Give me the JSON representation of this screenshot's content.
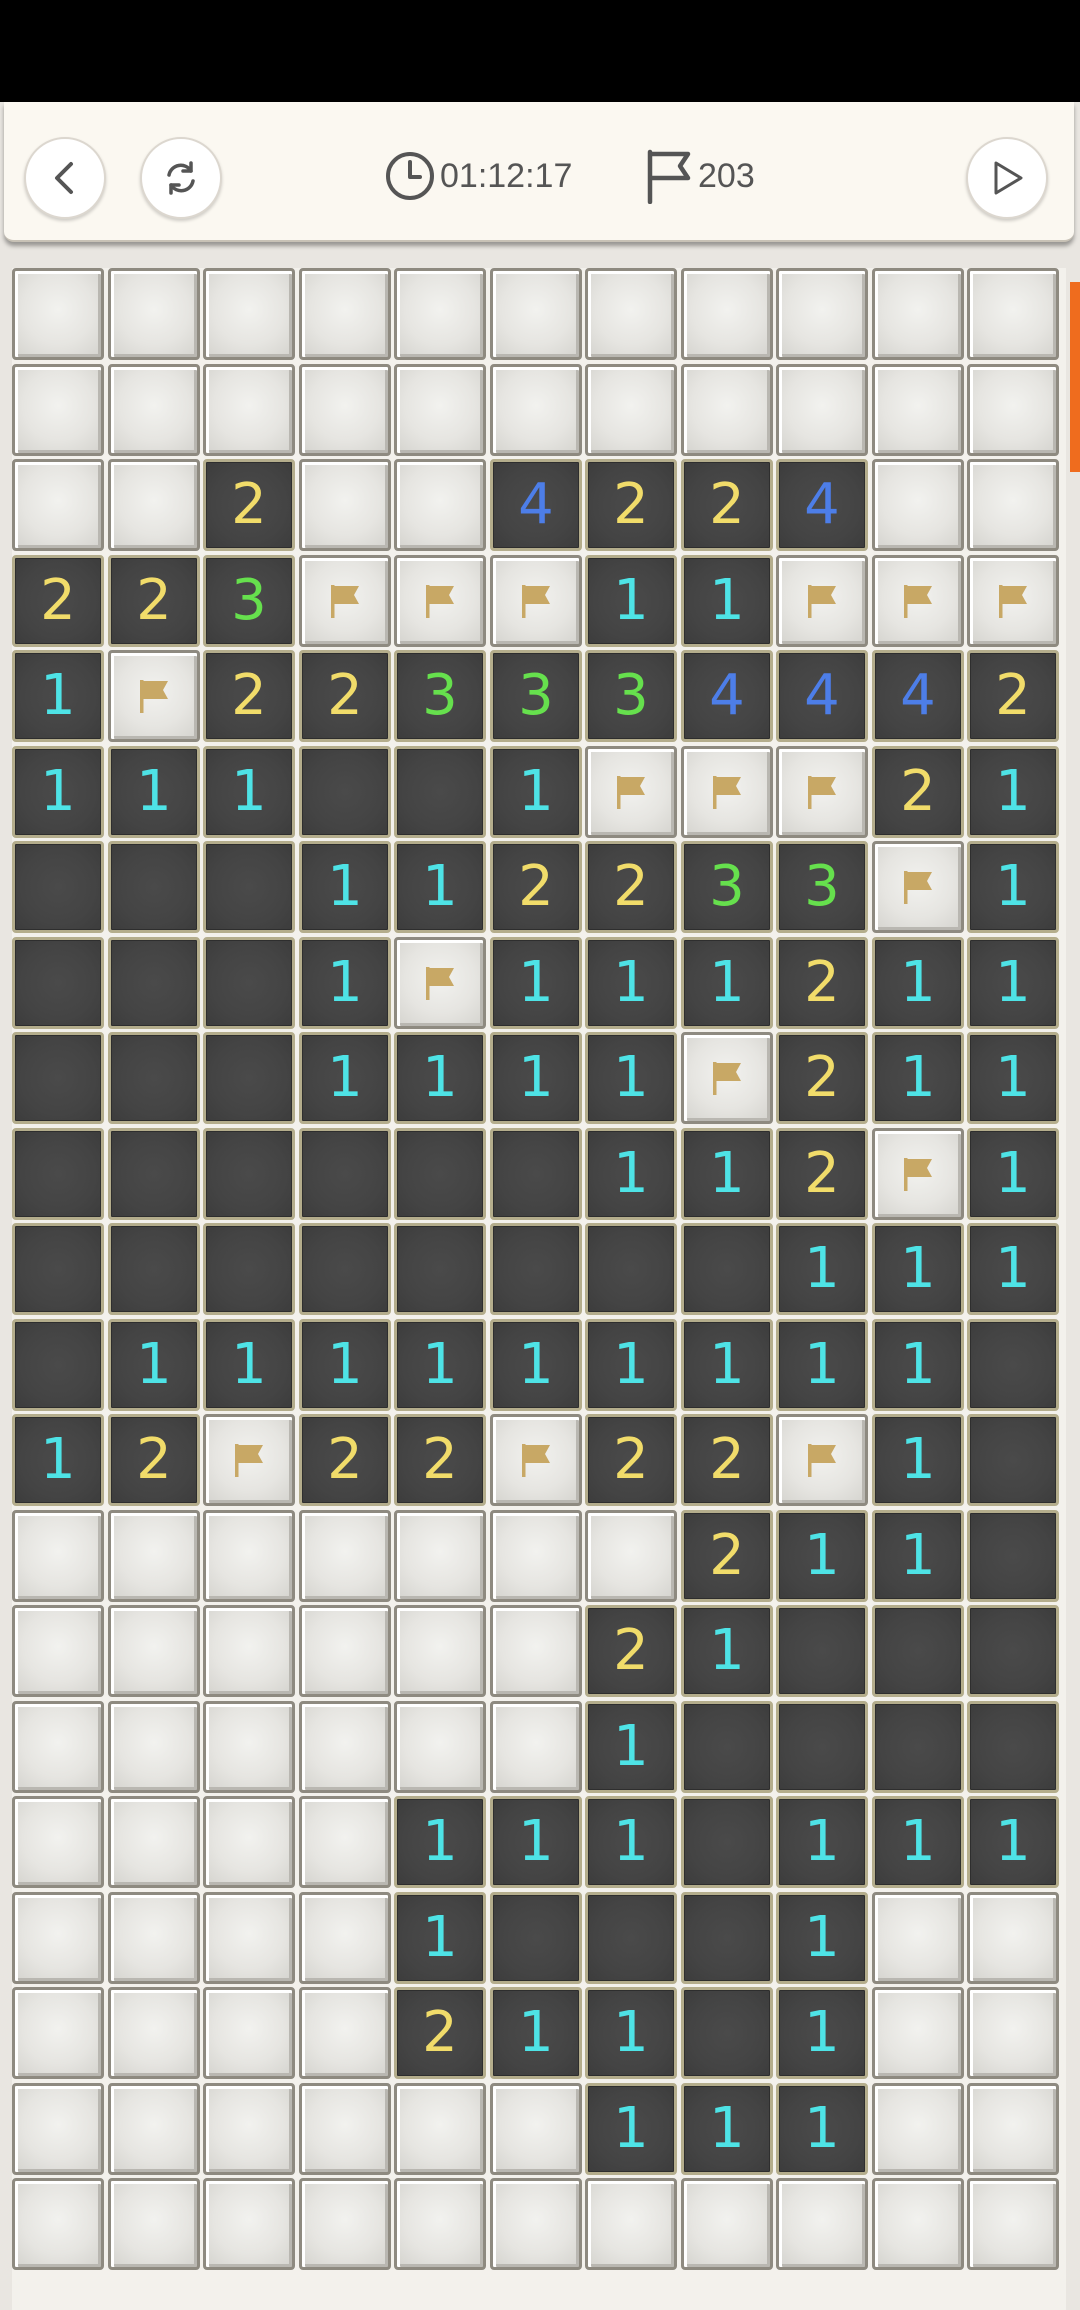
{
  "toolbar": {
    "back_icon": "chevron-left-icon",
    "restart_icon": "refresh-icon",
    "timer_icon": "clock-icon",
    "timer": "01:12:17",
    "flag_icon": "flag-outline-icon",
    "flag_count": "203",
    "play_icon": "play-icon"
  },
  "board": {
    "columns": 11,
    "legend": "C = covered tile, F = flagged tile, 0 = opened blank tile, 1-9 = opened tile showing that number",
    "rows": [
      [
        "C",
        "C",
        "C",
        "C",
        "C",
        "C",
        "C",
        "C",
        "C",
        "C",
        "C"
      ],
      [
        "C",
        "C",
        "C",
        "C",
        "C",
        "C",
        "C",
        "C",
        "C",
        "C",
        "C"
      ],
      [
        "C",
        "C",
        "2",
        "C",
        "C",
        "4",
        "2",
        "2",
        "4",
        "C",
        "C"
      ],
      [
        "2",
        "2",
        "3",
        "F",
        "F",
        "F",
        "1",
        "1",
        "F",
        "F",
        "F"
      ],
      [
        "1",
        "F",
        "2",
        "2",
        "3",
        "3",
        "3",
        "4",
        "4",
        "4",
        "2"
      ],
      [
        "1",
        "1",
        "1",
        "0",
        "0",
        "1",
        "F",
        "F",
        "F",
        "2",
        "1"
      ],
      [
        "0",
        "0",
        "0",
        "1",
        "1",
        "2",
        "2",
        "3",
        "3",
        "F",
        "1"
      ],
      [
        "0",
        "0",
        "0",
        "1",
        "F",
        "1",
        "1",
        "1",
        "2",
        "1",
        "1"
      ],
      [
        "0",
        "0",
        "0",
        "1",
        "1",
        "1",
        "1",
        "F",
        "2",
        "1",
        "1"
      ],
      [
        "0",
        "0",
        "0",
        "0",
        "0",
        "0",
        "1",
        "1",
        "2",
        "F",
        "1"
      ],
      [
        "0",
        "0",
        "0",
        "0",
        "0",
        "0",
        "0",
        "0",
        "1",
        "1",
        "1"
      ],
      [
        "0",
        "1",
        "1",
        "1",
        "1",
        "1",
        "1",
        "1",
        "1",
        "1",
        "0"
      ],
      [
        "1",
        "2",
        "F",
        "2",
        "2",
        "F",
        "2",
        "2",
        "F",
        "1",
        "0"
      ],
      [
        "C",
        "C",
        "C",
        "C",
        "C",
        "C",
        "C",
        "2",
        "1",
        "1",
        "0"
      ],
      [
        "C",
        "C",
        "C",
        "C",
        "C",
        "C",
        "2",
        "1",
        "0",
        "0",
        "0"
      ],
      [
        "C",
        "C",
        "C",
        "C",
        "C",
        "C",
        "1",
        "0",
        "0",
        "0",
        "0"
      ],
      [
        "C",
        "C",
        "C",
        "C",
        "1",
        "1",
        "1",
        "0",
        "1",
        "1",
        "1"
      ],
      [
        "C",
        "C",
        "C",
        "C",
        "1",
        "0",
        "0",
        "0",
        "1",
        "C",
        "C"
      ],
      [
        "C",
        "C",
        "C",
        "C",
        "2",
        "1",
        "1",
        "0",
        "1",
        "C",
        "C"
      ],
      [
        "C",
        "C",
        "C",
        "C",
        "C",
        "C",
        "1",
        "1",
        "1",
        "C",
        "C"
      ],
      [
        "C",
        "C",
        "C",
        "C",
        "C",
        "C",
        "C",
        "C",
        "C",
        "C",
        "C"
      ]
    ]
  },
  "colors": {
    "number_1": "#4ee3e6",
    "number_2": "#f1dc6a",
    "number_3": "#66e04d",
    "number_4": "#4d7ee8",
    "flag": "#c8a865",
    "scrollbar": "#ef6c1e"
  }
}
